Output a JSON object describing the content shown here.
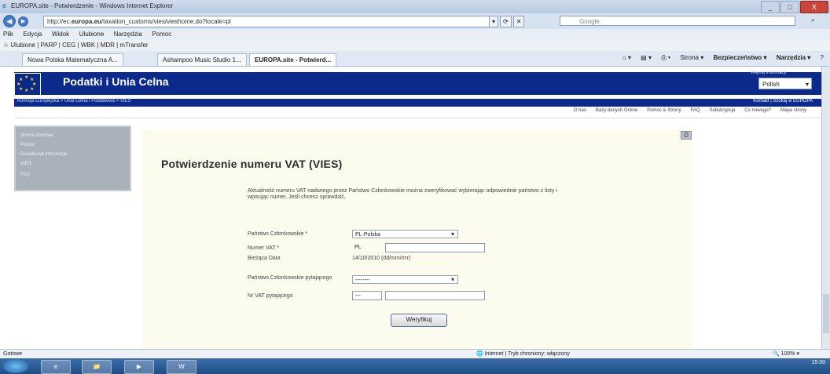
{
  "window": {
    "title": "EUROPA.site - Potwierdzenie - Windows Internet Explorer",
    "controls": [
      "_",
      "□",
      "X"
    ]
  },
  "address_bar": {
    "url_prefix": "http://ec.",
    "url_domain": "europa.eu",
    "url_rest": "/taxation_customs/vies/vieshome.do?locale=pl",
    "search_placeholder": "Google",
    "buttons": [
      "▾",
      "⟳",
      "✕"
    ]
  },
  "menu": [
    "Plik",
    "Edycja",
    "Widok",
    "Ulubione",
    "Narzędzia",
    "Pomoc"
  ],
  "favorites": "☆ Ulubione  |  PARP  |  CEG  |  WBK  |  MDR  |  mTransfer",
  "tabs": [
    "Nowa Polska Matematyczna A...",
    "Ashampoo Music Studio 1...",
    "EUROPA.site - Potwierd..."
  ],
  "command_bar": {
    "items": [
      "Strona ▾",
      "Bezpieczeństwo ▾",
      "Narzędzia ▾",
      "?"
    ]
  },
  "site": {
    "title": "Podatki i Unia Celna",
    "language_label": "Więcej informacji",
    "language": "Polish",
    "breadcrumb": "Komisja Europejska > Unia Celna i Podatkowa > VIES",
    "top_links": "Kontakt | Szukaj w EUROPA",
    "subnav": [
      "O nas",
      "Bazy danych Online",
      "Pomoc & Strony",
      "FAQ",
      "Subskrypcja",
      "Co nowego?",
      "Mapa strony"
    ],
    "sidebar": [
      "Strona domowa",
      "Pomoc",
      "Dodatkowe informacje",
      "VIES",
      "FAQ"
    ]
  },
  "form": {
    "heading": "Potwierdzenie numeru VAT (VIES)",
    "intro": "Aktualność numeru VAT nadanego przez Państwo Członkowskie można zweryfikować wybierając odpowiednie państwo z listy i wpisując numer. Jeśli chcesz sprawdzić,",
    "labels": {
      "member_state": "Państwo Członkowskie *",
      "vat_number": "Numer VAT *",
      "request_date": "Bieżąca Data",
      "requester_state": "Państwo Członkowskie pytającego",
      "requester_vat": "Nr VAT pytającego"
    },
    "values": {
      "member_state": "PL-Polska",
      "vat_prefix": "PL",
      "vat_number": "",
      "request_date": "14/10/2010 (dd/mm/rrrr)",
      "requester_state": "--------",
      "requester_prefix": "---",
      "requester_vat": ""
    },
    "submit": "Weryfikuj"
  },
  "status": {
    "left": "Gotowe",
    "zone": "Internet | Tryb chroniony: włączony",
    "zoom": "100%"
  },
  "taskbar": {
    "buttons": [
      "e",
      "📁",
      "▶",
      "W"
    ],
    "clock": "15:00"
  }
}
